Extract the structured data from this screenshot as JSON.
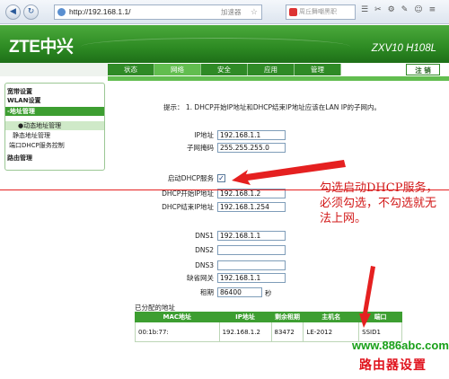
{
  "browser": {
    "url": "http://192.168.1.1/",
    "accelerator_label": "加速器",
    "search_placeholder": "周丘舞嘲黑职"
  },
  "router": {
    "logo": "ZTE中兴",
    "model": "ZXV10 H108L"
  },
  "tabs": [
    {
      "label": "状态",
      "active": false
    },
    {
      "label": "网络",
      "active": true
    },
    {
      "label": "安全",
      "active": false
    },
    {
      "label": "应用",
      "active": false
    },
    {
      "label": "管理",
      "active": false
    }
  ],
  "logout_label": "注 销",
  "sidebar": {
    "items": [
      {
        "label": "宽带设置"
      },
      {
        "label": "WLAN设置"
      },
      {
        "label": "-地址管理"
      },
      {
        "label": "●动态地址管理"
      },
      {
        "label": "静态地址管理"
      },
      {
        "label": "端口DHCP服务控制"
      },
      {
        "label": "路由管理"
      }
    ]
  },
  "form": {
    "hint": "提示： 1. DHCP开始IP地址和DHCP结束IP地址应该在LAN IP的子网内。",
    "ip_label": "IP地址",
    "ip_value": "192.168.1.1",
    "mask_label": "子网掩码",
    "mask_value": "255.255.255.0",
    "dhcp_enable_label": "启动DHCP服务",
    "dhcp_enabled": true,
    "dhcp_start_label": "DHCP开始IP地址",
    "dhcp_start_value": "192.168.1.2",
    "dhcp_end_label": "DHCP结束IP地址",
    "dhcp_end_value": "192.168.1.254",
    "dns1_label": "DNS1",
    "dns1_value": "192.168.1.1",
    "dns2_label": "DNS2",
    "dns2_value": "",
    "dns3_label": "DNS3",
    "dns3_value": "",
    "gateway_label": "缺省网关",
    "gateway_value": "192.168.1.1",
    "lease_label": "租期",
    "lease_value": "86400",
    "lease_unit": "秒"
  },
  "assigned": {
    "title": "已分配的地址",
    "headers": [
      "MAC地址",
      "IP地址",
      "剩余租期",
      "主机名",
      "端口"
    ],
    "rows": [
      {
        "mac": "00:1b:77:",
        "ip": "192.168.1.2",
        "remaining": "83472",
        "host": "LE-2012",
        "port": "SSID1"
      }
    ]
  },
  "annotation": {
    "text": "勾选启动DHCP服务，必须勾选，不勾选就无法上网。"
  },
  "watermark": {
    "url": "www.886abc.com",
    "title": "路由器设置"
  },
  "colors": {
    "brand_green": "#2d8a23",
    "active_tab": "#62bd4f",
    "annotation_red": "#d21919"
  }
}
